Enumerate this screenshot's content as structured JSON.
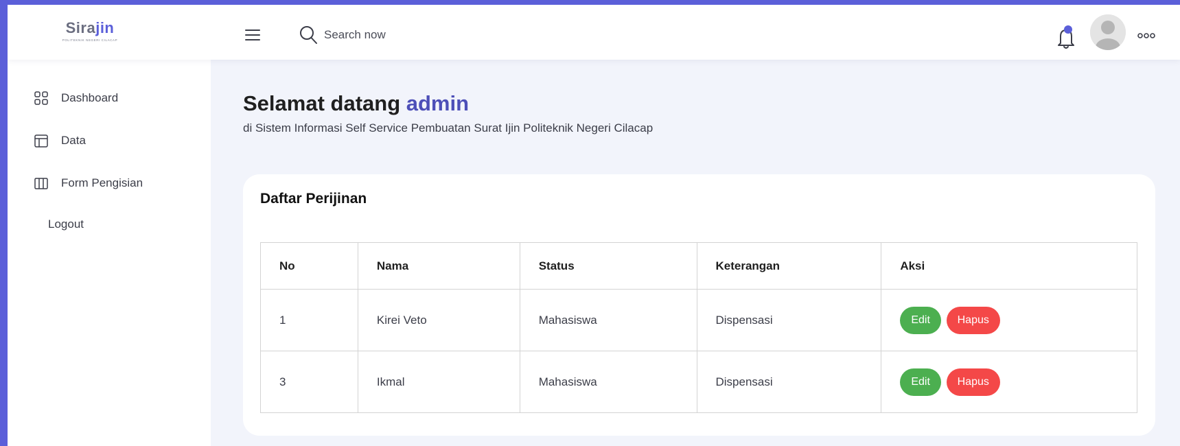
{
  "app": {
    "logo_text_main": "Sira",
    "logo_text_accent": "jin",
    "logo_subtitle": "POLITEKNIK NEGERI CILACAP"
  },
  "header": {
    "search_placeholder": "Search now",
    "notification_dot_color": "#5b5fd9"
  },
  "sidebar": {
    "items": [
      {
        "label": "Dashboard",
        "icon": "grid-icon"
      },
      {
        "label": "Data",
        "icon": "layout-icon"
      },
      {
        "label": "Form Pengisian",
        "icon": "columns-icon"
      },
      {
        "label": "Logout",
        "icon": ""
      }
    ]
  },
  "main": {
    "greeting": "Selamat datang",
    "username": "admin",
    "subtitle": "di Sistem Informasi Self Service Pembuatan Surat Ijin Politeknik Negeri Cilacap",
    "card_title": "Daftar Perijinan",
    "table": {
      "headers": [
        "No",
        "Nama",
        "Status",
        "Keterangan",
        "Aksi"
      ],
      "rows": [
        {
          "no": "1",
          "nama": "Kirei Veto",
          "status": "Mahasiswa",
          "keterangan": "Dispensasi"
        },
        {
          "no": "3",
          "nama": "Ikmal",
          "status": "Mahasiswa",
          "keterangan": "Dispensasi"
        }
      ],
      "edit_label": "Edit",
      "delete_label": "Hapus"
    }
  },
  "colors": {
    "accent": "#5b5fd9",
    "edit_button": "#4caf50",
    "delete_button": "#f44848"
  }
}
